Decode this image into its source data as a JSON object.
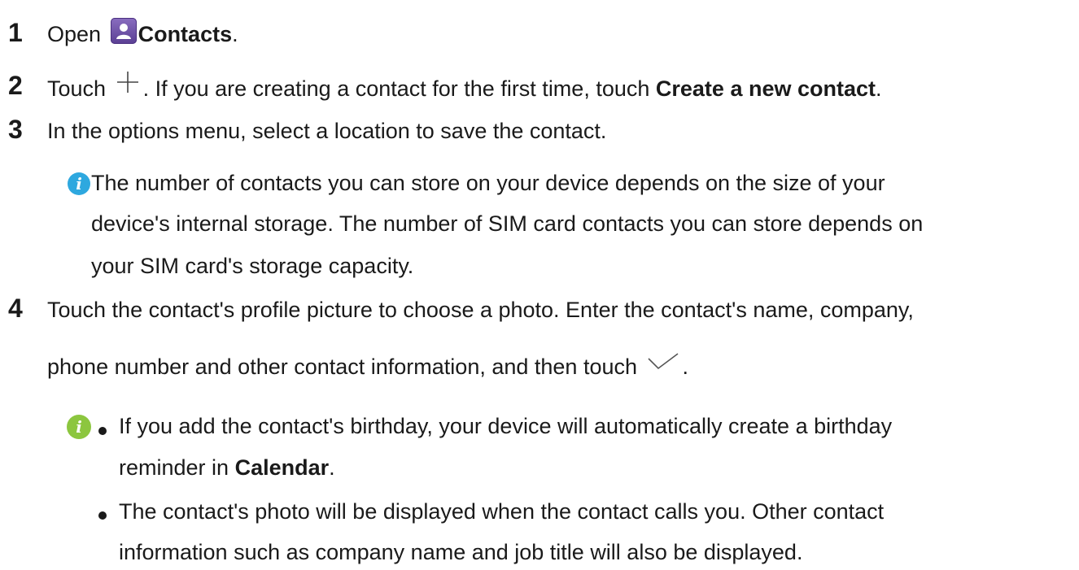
{
  "step1": {
    "number": "1",
    "prefix": "Open",
    "app_name": "Contacts",
    "suffix": ".",
    "icon": "contacts-app-icon"
  },
  "step2": {
    "number": "2",
    "prefix": "Touch",
    "icon": "plus-icon",
    "middle": ". If you are creating a contact for the first time, touch",
    "action": "Create a new contact",
    "suffix": "."
  },
  "step3": {
    "number": "3",
    "text": "In the options menu, select a location to save the contact.",
    "note_icon": "info-icon",
    "note_lines": [
      "The number of contacts you can store on your device depends on the size of your",
      "device's internal storage. The number of SIM card contacts you can store depends on",
      "your SIM card's storage capacity."
    ]
  },
  "step4": {
    "number": "4",
    "line1": "Touch the contact's profile picture to choose a photo. Enter the contact's name, company,",
    "line2": "phone number and other contact information, and then touch",
    "line2_icon": "checkmark-icon",
    "line2_suffix": ".",
    "note_icon": "info-icon",
    "bullet1_line1": "If you add the contact's birthday, your device will automatically create a birthday",
    "bullet1_line2_prefix": "reminder in",
    "bullet1_app": "Calendar",
    "bullet1_line2_suffix": ".",
    "bullet2_line1": "The contact's photo will be displayed when the contact calls you. Other contact",
    "bullet2_line2": "information such as company name and job title will also be displayed."
  }
}
